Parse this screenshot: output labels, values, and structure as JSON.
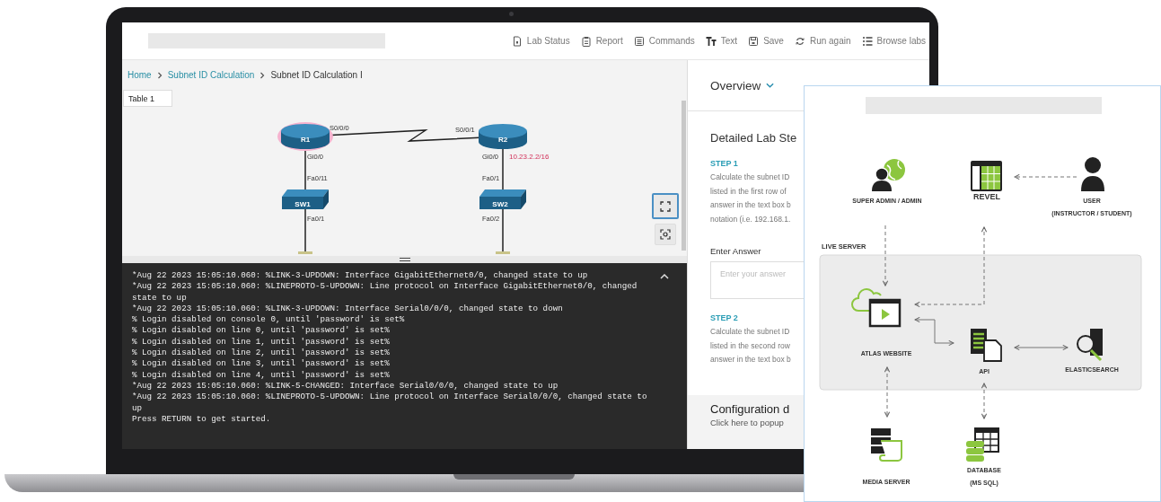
{
  "toolbar": [
    {
      "label": "Lab Status"
    },
    {
      "label": "Report"
    },
    {
      "label": "Commands"
    },
    {
      "label": "Text"
    },
    {
      "label": "Save"
    },
    {
      "label": "Run again"
    },
    {
      "label": "Browse labs"
    }
  ],
  "breadcrumb": [
    {
      "label": "Home",
      "kind": "link"
    },
    {
      "label": "Subnet ID Calculation",
      "kind": "link"
    },
    {
      "label": "Subnet ID Calculation I",
      "kind": "current"
    }
  ],
  "table_button": "Table 1",
  "topology": {
    "devices": [
      {
        "name": "R1",
        "kind": "router",
        "highlighted": true
      },
      {
        "name": "R2",
        "kind": "router",
        "highlighted": false
      },
      {
        "name": "SW1",
        "kind": "switch",
        "highlighted": false
      },
      {
        "name": "SW2",
        "kind": "switch",
        "highlighted": false
      }
    ],
    "port_labels": [
      "S0/0/0",
      "S0/0/1",
      "Gi0/0",
      "Gi0/0",
      "Fa0/11",
      "Fa0/1",
      "Fa0/1",
      "Fa0/2"
    ],
    "ip_label": "10.23.2.2/16"
  },
  "console_lines": [
    "*Aug 22 2023 15:05:10.060: %LINK-3-UPDOWN: Interface GigabitEthernet0/0, changed state to up",
    "*Aug 22 2023 15:05:10.060: %LINEPROTO-5-UPDOWN: Line protocol on Interface GigabitEthernet0/0, changed state to up",
    "*Aug 22 2023 15:05:10.060: %LINK-3-UPDOWN: Interface Serial0/0/0, changed state to down",
    "% Login disabled on console 0, until 'password' is set%",
    "% Login disabled on line 0, until 'password' is set%",
    "% Login disabled on line 1, until 'password' is set%",
    "% Login disabled on line 2, until 'password' is set%",
    "% Login disabled on line 3, until 'password' is set%",
    "% Login disabled on line 4, until 'password' is set%",
    "*Aug 22 2023 15:05:10.060: %LINK-5-CHANGED: Interface Serial0/0/0, changed state to up",
    "*Aug 22 2023 15:05:10.060: %LINEPROTO-5-UPDOWN: Line protocol on Interface Serial0/0/0, changed state to up",
    "Press RETURN to get started."
  ],
  "panel": {
    "overview": "Overview",
    "steps_title": "Detailed Lab Ste",
    "steps": [
      {
        "heading": "STEP 1",
        "lines": [
          "Calculate the subnet ID",
          "listed in the first row of",
          "answer in the text box b",
          "notation (i.e. 192.168.1."
        ],
        "answer_label": "Enter Answer",
        "placeholder": "Enter your answer"
      },
      {
        "heading": "STEP 2",
        "lines": [
          "Calculate the subnet ID",
          "listed in the second row",
          "answer in the text box b"
        ]
      }
    ],
    "configuration": {
      "title": "Configuration d",
      "hint": "Click here to popup"
    }
  },
  "architecture": {
    "section_label": "LIVE SERVER",
    "nodes": [
      {
        "label": "SUPER ADMIN / ADMIN"
      },
      {
        "label": "REVEL"
      },
      {
        "label": "USER",
        "sublabel": "(INSTRUCTOR / STUDENT)"
      },
      {
        "label": "ATLAS WEBSITE"
      },
      {
        "label": "API"
      },
      {
        "label": "ELASTICSEARCH"
      },
      {
        "label": "MEDIA SERVER"
      },
      {
        "label": "DATABASE",
        "sublabel": "(MS SQL)"
      }
    ]
  }
}
